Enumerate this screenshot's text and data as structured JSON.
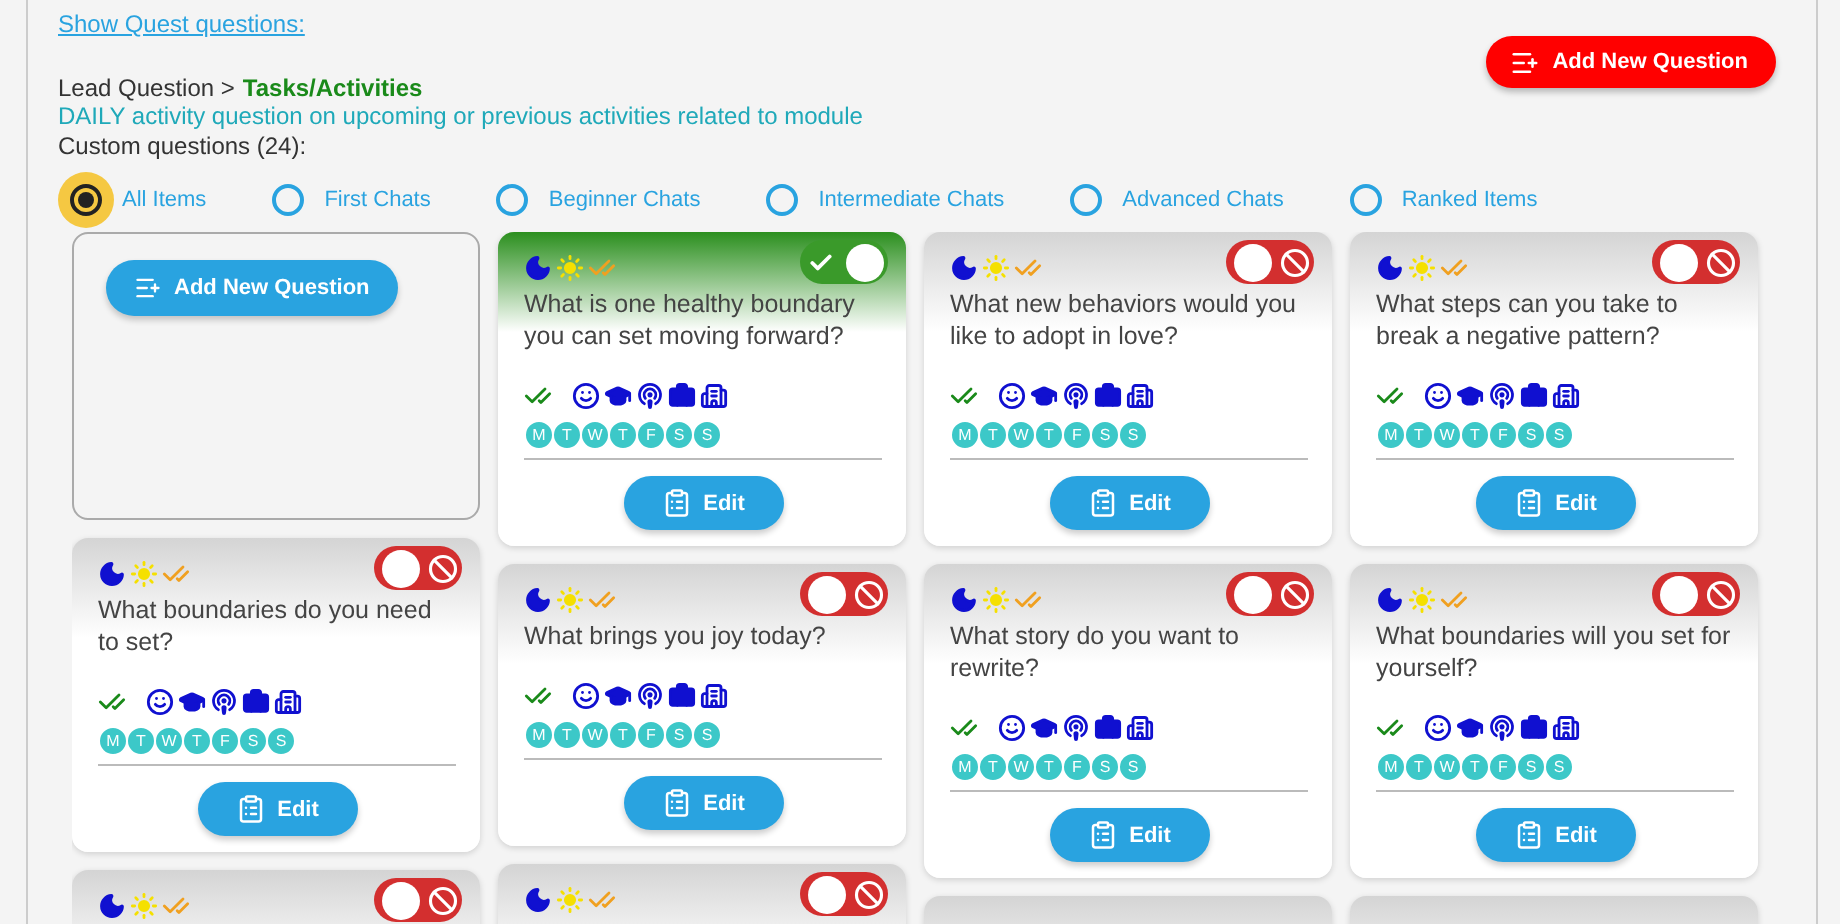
{
  "quest_link": "Show Quest questions:",
  "add_button": "Add New Question",
  "breadcrumb": {
    "parent": "Lead Question >",
    "current": "Tasks/Activities"
  },
  "description": "DAILY activity question on upcoming or previous activities related to module",
  "count_label": "Custom questions (24):",
  "filters": [
    {
      "label": "All Items",
      "selected": true
    },
    {
      "label": "First Chats",
      "selected": false
    },
    {
      "label": "Beginner Chats",
      "selected": false
    },
    {
      "label": "Intermediate Chats",
      "selected": false
    },
    {
      "label": "Advanced Chats",
      "selected": false
    },
    {
      "label": "Ranked Items",
      "selected": false
    }
  ],
  "columns": [
    {
      "cards": [
        {
          "kind": "add",
          "label": "Add New Question"
        },
        {
          "kind": "question",
          "enabled": false,
          "question": "What boundaries do you need to set?",
          "days": [
            "M",
            "T",
            "W",
            "T",
            "F",
            "S",
            "S"
          ],
          "edit": "Edit"
        },
        {
          "kind": "question",
          "enabled": false
        }
      ]
    },
    {
      "cards": [
        {
          "kind": "question",
          "enabled": true,
          "question": "What is one healthy boundary you can set moving forward?",
          "days": [
            "M",
            "T",
            "W",
            "T",
            "F",
            "S",
            "S"
          ],
          "edit": "Edit"
        },
        {
          "kind": "question",
          "enabled": false,
          "question": "What brings you joy today?",
          "days": [
            "M",
            "T",
            "W",
            "T",
            "F",
            "S",
            "S"
          ],
          "edit": "Edit"
        },
        {
          "kind": "question",
          "enabled": false
        }
      ]
    },
    {
      "cards": [
        {
          "kind": "question",
          "enabled": false,
          "question": "What new behaviors would you like to adopt in love?",
          "days": [
            "M",
            "T",
            "W",
            "T",
            "F",
            "S",
            "S"
          ],
          "edit": "Edit"
        },
        {
          "kind": "question",
          "enabled": false,
          "question": "What story do you want to rewrite?",
          "days": [
            "M",
            "T",
            "W",
            "T",
            "F",
            "S",
            "S"
          ],
          "edit": "Edit"
        },
        {
          "kind": "stub"
        }
      ]
    },
    {
      "cards": [
        {
          "kind": "question",
          "enabled": false,
          "question": "What steps can you take to break a negative pattern?",
          "days": [
            "M",
            "T",
            "W",
            "T",
            "F",
            "S",
            "S"
          ],
          "edit": "Edit"
        },
        {
          "kind": "question",
          "enabled": false,
          "question": "What boundaries will you set for yourself?",
          "days": [
            "M",
            "T",
            "W",
            "T",
            "F",
            "S",
            "S"
          ],
          "edit": "Edit"
        },
        {
          "kind": "stub"
        }
      ]
    }
  ]
}
